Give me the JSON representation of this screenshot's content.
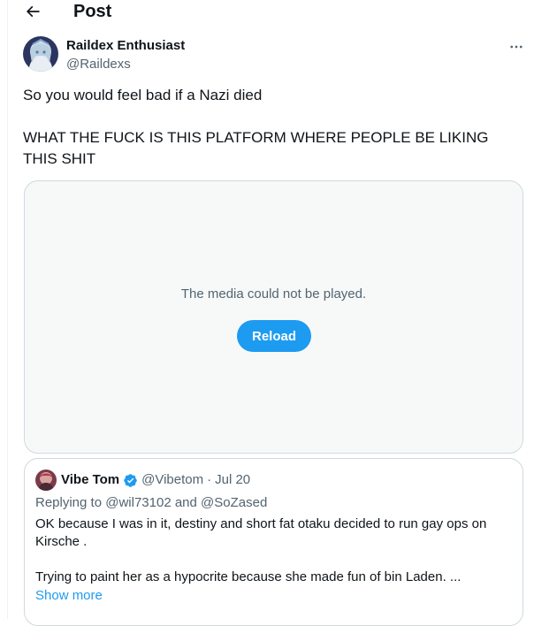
{
  "header": {
    "title": "Post"
  },
  "tweet": {
    "author": {
      "name": "Raildex Enthusiast",
      "handle": "@Raildexs"
    },
    "text_line1": "So you would feel bad if a Nazi died",
    "text_line2": "WHAT THE FUCK IS THIS PLATFORM WHERE PEOPLE BE LIKING THIS SHIT"
  },
  "media": {
    "message": "The media could not be played.",
    "reload_label": "Reload"
  },
  "quote": {
    "name": "Vibe Tom",
    "handle": "@Vibetom",
    "separator": "·",
    "date": "Jul 20",
    "replying_prefix": "Replying to ",
    "replying_to_1": "@wil73102",
    "replying_and": " and ",
    "replying_to_2": "@SoZased",
    "paragraph1": "OK because I was in it, destiny and short fat otaku decided to run gay ops on Kirsche .",
    "paragraph2": "Trying to paint her as a hypocrite because she made fun of bin Laden. ...",
    "show_more": "Show more"
  },
  "colors": {
    "accent": "#1d9bf0",
    "text": "#0f1419",
    "secondary": "#536471",
    "border": "#cfd9de"
  },
  "icons": {
    "back": "arrow-left-icon",
    "more": "more-horizontal-icon",
    "verified": "verified-badge-icon"
  }
}
